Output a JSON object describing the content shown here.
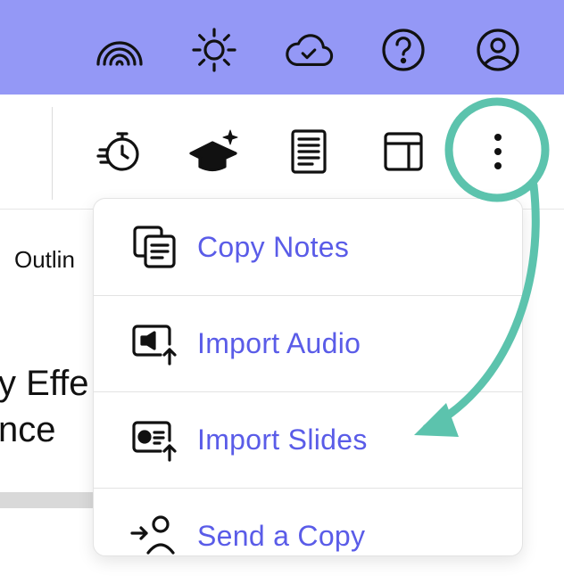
{
  "top_bar": {
    "color": "#9498f6",
    "icons": [
      "rainbow-icon",
      "sun-icon",
      "cloud-check-icon",
      "help-icon",
      "user-icon"
    ]
  },
  "toolbar": {
    "icons": [
      "timer-icon",
      "graduation-cap-sparkle-icon",
      "notes-icon",
      "layout-icon",
      "more-vertical-icon"
    ]
  },
  "background_page": {
    "tab_label": "Outlin",
    "title_lines": [
      "y Effe",
      "nce"
    ]
  },
  "dropdown_menu": {
    "items": [
      {
        "label": "Copy Notes",
        "icon": "copy-notes-icon"
      },
      {
        "label": "Import Audio",
        "icon": "import-audio-icon"
      },
      {
        "label": "Import Slides",
        "icon": "import-slides-icon"
      },
      {
        "label": "Send a Copy",
        "icon": "send-copy-icon"
      }
    ],
    "label_color": "#5a5ce8"
  },
  "annotation": {
    "color": "#5cc3ad",
    "highlight": "more-vertical-icon",
    "points_to": "Import Slides"
  }
}
